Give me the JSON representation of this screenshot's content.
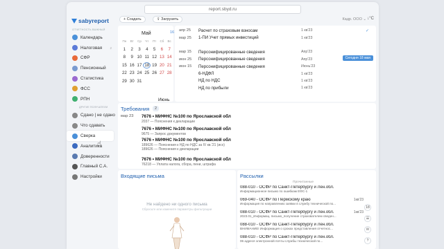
{
  "browser": {
    "url": "report.sbyd.ru"
  },
  "app": {
    "logo": "sabyreport",
    "org": "ОТЧЕТНОСТЬ ВАЖНЫЙ"
  },
  "sidebar": {
    "items": [
      {
        "label": "Календарь",
        "color": "#4a90d9"
      },
      {
        "label": "Налоговая",
        "color": "#5c7bd8",
        "count": "2"
      },
      {
        "label": "СФР",
        "color": "#e86a3a"
      },
      {
        "label": "Пенсионный",
        "color": "#7a9bd0"
      },
      {
        "label": "Статистика",
        "color": "#9b6ad0"
      },
      {
        "label": "ФСС",
        "color": "#e0a030"
      },
      {
        "label": "РПН",
        "color": "#40b070"
      }
    ],
    "group_label": "ДРУГИЕ ПОЛУЧАТЕЛИ",
    "items2": [
      {
        "label": "Сдано | не сдано",
        "color": "#888"
      },
      {
        "label": "Что сдавать",
        "color": "#888"
      },
      {
        "label": "Сверка",
        "color": "#4a90d9"
      },
      {
        "label": "Аналитика",
        "color": "#3b6ac0"
      },
      {
        "label": "Доверенности",
        "color": "#5a7ab0"
      },
      {
        "label": "Главный С.А.",
        "color": "#555"
      },
      {
        "label": "Настройки",
        "color": "#777"
      }
    ]
  },
  "toolbar": {
    "create": "+ Создать",
    "upload": "⇪ Загрузить",
    "company": "Кадр. ООО ⌄",
    "sort": "↓°C"
  },
  "calendar": {
    "month": "Май",
    "next_month": "Июнь",
    "badge": "16",
    "weekdays": [
      "Пн",
      "Вт",
      "Ср",
      "Чт",
      "Пт",
      "Сб",
      "Вс"
    ],
    "rows": [
      [
        "1",
        "2",
        "3",
        "4",
        "5",
        "6",
        "7"
      ],
      [
        "8",
        "9",
        "10",
        "11",
        "12",
        "13",
        "14"
      ],
      [
        "15",
        "16",
        "17",
        "18",
        "19",
        "20",
        "21"
      ],
      [
        "22",
        "23",
        "24",
        "25",
        "26",
        "27",
        "28"
      ],
      [
        "29",
        "30",
        "31",
        "",
        "",
        "",
        ""
      ]
    ]
  },
  "events": [
    {
      "date": "апр 25",
      "title": "Расчет по страховым взносам",
      "due": "1 кв'23"
    },
    {
      "date": "мар 25",
      "title": "1-ПИ Учет прямых инвестиций",
      "due": "1 кв'23"
    },
    {
      "date": "",
      "title": "",
      "due": ""
    },
    {
      "date": "мар 15",
      "title": "Персонифицированные сведения",
      "due": "Апр'23"
    },
    {
      "date": "июн 25",
      "title": "Персонифицированные сведения",
      "due": "Апр'23"
    },
    {
      "date": "июн 15",
      "title": "Персонифицированные сведения",
      "due": "Июнь'23"
    },
    {
      "date": "",
      "title": "6-НДФЛ",
      "due": "1 кв'23"
    },
    {
      "date": "",
      "title": "НД по НДС",
      "due": "1 кв'23"
    },
    {
      "date": "",
      "title": "НД по прибыли",
      "due": "1 кв'23"
    }
  ],
  "today_badge": "Сегодня 18 мая",
  "requirements": {
    "title": "Требования",
    "count": "2",
    "items": [
      {
        "date": "мар 23",
        "title": "7676 • МИФНС №100 по Ярославской обл",
        "sub": [
          "2037 — Пояснения к декларации"
        ]
      },
      {
        "date": "",
        "title": "7676 • МИФНС №100 по Ярославской обл",
        "sub": [
          "9675 — Запрос документов"
        ]
      },
      {
        "date": "",
        "title": "7676 • МИФНС №100 по Ярославской обл",
        "sub": [
          "189626 — Пояснения к НД по НДС за IV кв.'21 (исх)",
          "189626 — Пояснения к декларации"
        ]
      },
      {
        "date": "",
        "title": "7676 • МИФНС №100 по Ярославской обл",
        "sub": [
          "76218 — Уплата налога, сбора, пени, штрафа"
        ]
      }
    ]
  },
  "inbox": {
    "title": "Входящие письма",
    "empty": "Не найдено ни одного письма",
    "hint": "Сбросьте или измените параметры фильтрации"
  },
  "mailings": {
    "title": "Рассылки",
    "group": "Прочитанные",
    "items": [
      {
        "title": "088-010 - ОСФР по Санкт-Петербургу и Лен.обл.",
        "sub": "Информационное письмо по ошибкам ЕФС-1",
        "date": ""
      },
      {
        "title": "069-040 - ОСФР по Пермскому краю",
        "sub": "Информация по направлению заявки в службу технической по...",
        "date": "1кв'23"
      },
      {
        "title": "088-010 - ОСФР по Санкт-Петербургу и Лен.обл.",
        "sub": "2023.01_Информац. письмо_получение страхователем сведен...",
        "date": "1кв'23"
      },
      {
        "title": "088-010 - ОСФР по Санкт-Петербургу и Лен.обл.",
        "sub": "ВНИМАНИЕ! Информация о сроках представления отчетнос...",
        "date": ""
      },
      {
        "title": "088-010 - ОСФР по Санкт-Петербургу и Лен.обл.",
        "sub": "06 адреся электронной почты службы технической по...",
        "date": ""
      }
    ]
  },
  "fab": [
    "18",
    "",
    "",
    "?"
  ]
}
